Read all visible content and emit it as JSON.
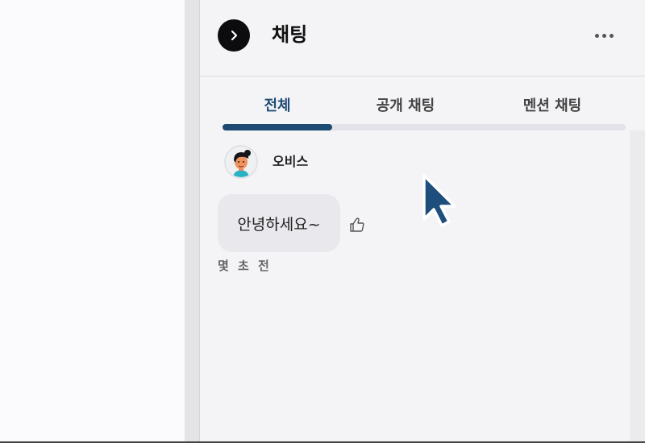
{
  "header": {
    "title": "채팅",
    "collapse_icon": "chevron-right-icon",
    "more_icon": "more-horizontal-icon"
  },
  "tabs": [
    {
      "label": "전체",
      "active": true
    },
    {
      "label": "공개 채팅",
      "active": false
    },
    {
      "label": "멘션 채팅",
      "active": false
    }
  ],
  "messages": [
    {
      "sender": "오비스",
      "text": "안녕하세요~",
      "time": "몇 초 전",
      "like_icon": "thumbs-up-icon"
    }
  ],
  "colors": {
    "accent": "#1c4a72",
    "panel_bg": "#f4f3f6",
    "bubble_bg": "#e9e8ed"
  }
}
